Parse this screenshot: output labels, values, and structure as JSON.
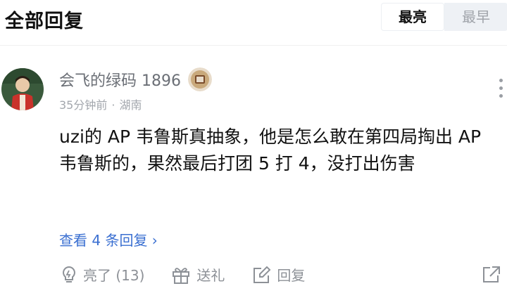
{
  "header": {
    "title": "全部回复",
    "sort_options": [
      {
        "label": "最亮",
        "active": true
      },
      {
        "label": "最早",
        "active": false
      }
    ]
  },
  "comment": {
    "username": "会飞的绿码 1896",
    "time": "35分钟前",
    "location": "湖南",
    "text": "uzi的 AP 韦鲁斯真抽象，他是怎么敢在第四局掏出 AP 韦鲁斯的，果然最后打团 5 打 4，没打出伤害",
    "replies_link": "查看 4 条回复 ›",
    "actions": {
      "like": "亮了 (13)",
      "gift": "送礼",
      "reply": "回复"
    }
  },
  "colors": {
    "link": "#3a6fd1",
    "muted": "#8d9197"
  },
  "icons": [
    "more-vertical-icon",
    "lightbulb-icon",
    "gift-icon",
    "edit-icon",
    "share-icon"
  ]
}
